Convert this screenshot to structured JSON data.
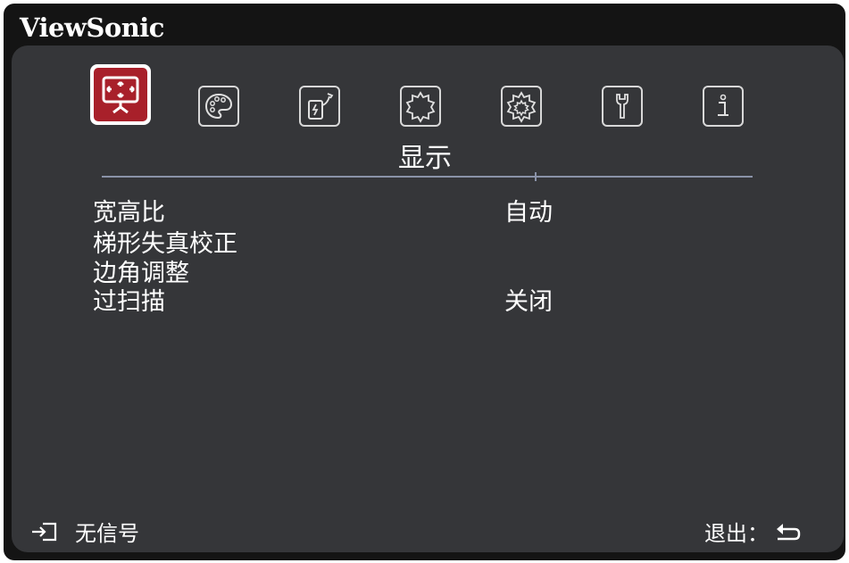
{
  "brand": {
    "name": "ViewSonic"
  },
  "tabs": [
    {
      "icon": "display-icon",
      "active": true
    },
    {
      "icon": "palette-icon",
      "active": false
    },
    {
      "icon": "power-icon",
      "active": false
    },
    {
      "icon": "basic-gear-icon",
      "active": false
    },
    {
      "icon": "advanced-gear-icon",
      "active": false
    },
    {
      "icon": "wrench-icon",
      "active": false
    },
    {
      "icon": "info-icon",
      "active": false
    }
  ],
  "section": {
    "title": "显示"
  },
  "menu": {
    "items": [
      {
        "label": "宽高比",
        "value": "自动"
      },
      {
        "label": "梯形失真校正",
        "value": ""
      },
      {
        "label": "边角调整",
        "value": ""
      },
      {
        "label": "过扫描",
        "value": "关闭"
      }
    ]
  },
  "footer": {
    "source_icon": "input-source-icon",
    "source_status": "无信号",
    "exit_label": "退出：",
    "exit_icon": "return-icon"
  }
}
